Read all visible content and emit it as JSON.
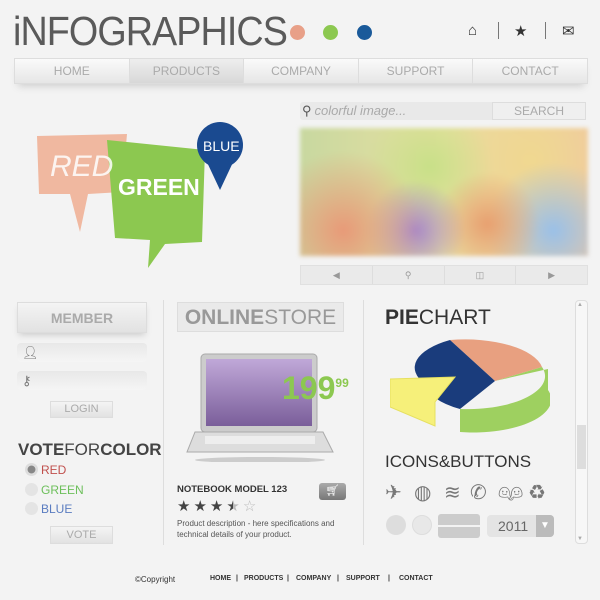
{
  "header": {
    "title": "iNFOGRAPHICS",
    "dots": [
      "#e8a088",
      "#8cc850",
      "#1a5a9a"
    ],
    "icons": [
      "home-icon",
      "star-icon",
      "mail-icon"
    ]
  },
  "nav": [
    {
      "label": "HOME"
    },
    {
      "label": "PRODUCTS",
      "active": true
    },
    {
      "label": "COMPANY"
    },
    {
      "label": "SUPPORT"
    },
    {
      "label": "CONTACT"
    }
  ],
  "search": {
    "placeholder": "colorful image...",
    "button": "SEARCH"
  },
  "gallery": {
    "controls": [
      "◀",
      "⚲",
      "◫",
      "▶"
    ]
  },
  "banners": {
    "red": "RED",
    "green": "GREEN",
    "blue": "BLUE"
  },
  "member": {
    "title": "MEMBER",
    "login": "LOGIN"
  },
  "vote": {
    "title_bold1": "VOTE",
    "title_light": "FOR",
    "title_bold2": "COLOR",
    "options": [
      {
        "label": "RED",
        "color": "#c0504d",
        "selected": true
      },
      {
        "label": "GREEN",
        "color": "#6cbf5a",
        "selected": false
      },
      {
        "label": "BLUE",
        "color": "#5a7cc0",
        "selected": false
      }
    ],
    "button": "VOTE"
  },
  "store": {
    "title_bold": "ONLINE",
    "title_light": "STORE",
    "price_main": "199",
    "price_cents": "99",
    "product": "NOTEBOOK MODEL 123",
    "rating": 3.5,
    "rating_max": 5,
    "description": "Product description - here specifications and technical details of your product."
  },
  "pie": {
    "title_bold": "PIE",
    "title_light": "CHART"
  },
  "icons": {
    "title": "ICONS&BUTTONS",
    "items": [
      "airplane-icon",
      "globe-icon",
      "rss-icon",
      "phone-icon",
      "restroom-icon",
      "recycle-icon"
    ],
    "year": "2011"
  },
  "footer": {
    "copyright": "©Copyright",
    "links": [
      "HOME",
      "PRODUCTS",
      "COMPANY",
      "SUPPORT",
      "CONTACT"
    ]
  }
}
